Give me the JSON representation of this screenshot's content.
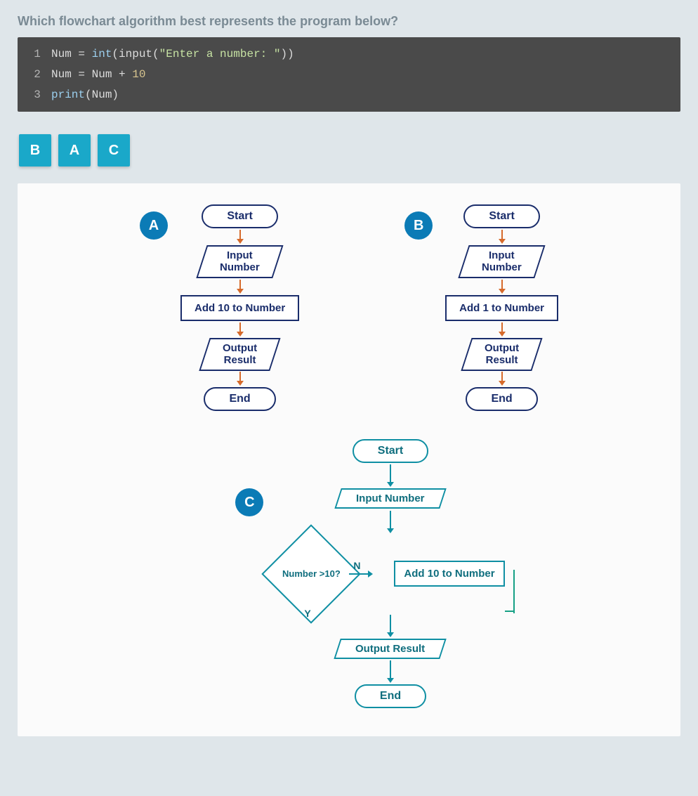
{
  "question": "Which flowchart algorithm best represents the program below?",
  "code": {
    "line1_num": "1",
    "line1_a": "Num = ",
    "line1_b": "int",
    "line1_c": "(input(",
    "line1_d": "\"Enter a number: \"",
    "line1_e": "))",
    "line2_num": "2",
    "line2_a": "Num = Num + ",
    "line2_b": "10",
    "line3_num": "3",
    "line3_a": "print",
    "line3_b": "(Num)"
  },
  "answer_cards": {
    "b": "B",
    "a": "A",
    "c": "C"
  },
  "flowA": {
    "badge": "A",
    "start": "Start",
    "input": "Input\nNumber",
    "process": "Add 10 to Number",
    "output": "Output\nResult",
    "end": "End"
  },
  "flowB": {
    "badge": "B",
    "start": "Start",
    "input": "Input\nNumber",
    "process": "Add 1 to Number",
    "output": "Output\nResult",
    "end": "End"
  },
  "flowC": {
    "badge": "C",
    "start": "Start",
    "input": "Input Number",
    "decision": "Number >10?",
    "n": "N",
    "y": "Y",
    "side": "Add 10 to Number",
    "output": "Output Result",
    "end": "End"
  }
}
